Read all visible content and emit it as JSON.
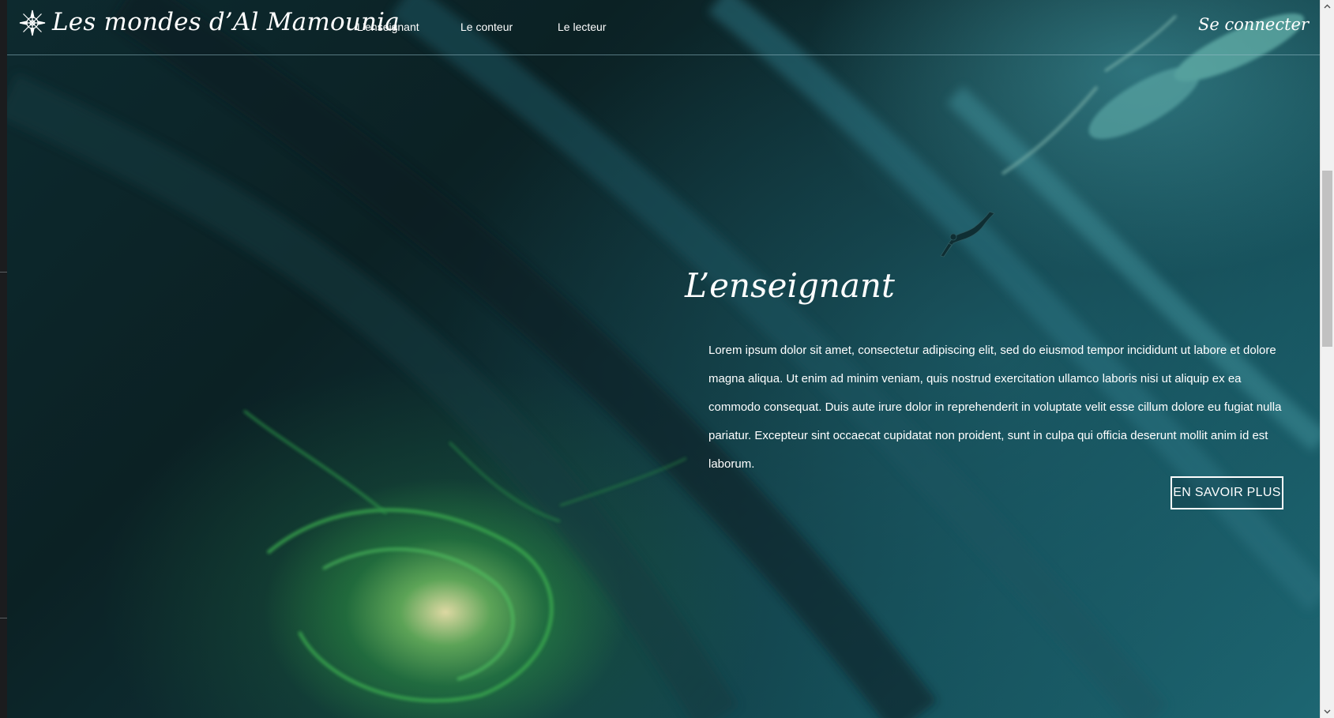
{
  "header": {
    "logo_icon": "compass-rose-icon",
    "site_title": "Les mondes d’Al Mamounia",
    "nav": [
      {
        "label": "L’enseignant"
      },
      {
        "label": "Le conteur"
      },
      {
        "label": "Le lecteur"
      }
    ],
    "login_label": "Se connecter"
  },
  "hero": {
    "title": "L’enseignant",
    "text": "Lorem ipsum dolor sit amet, consectetur adipiscing elit, sed do eiusmod tempor incididunt ut labore et dolore magna aliqua. Ut enim ad minim veniam, quis nostrud exercitation ullamco laboris nisi ut aliquip ex ea commodo consequat. Duis aute irure dolor in reprehenderit in voluptate velit esse cillum dolore eu fugiat nulla pariatur. Excepteur sint occaecat cupidatat non proident, sunt in culpa qui officia deserunt mollit anim id est laborum.",
    "button_label": "EN SAVOIR PLUS",
    "background_description_colors": {
      "deep": "#0b2124",
      "teal": "#1d6672",
      "glow": "#7fe07a"
    }
  },
  "scrollbar": {
    "up_icon": "chevron-up-icon",
    "down_icon": "chevron-down-icon"
  }
}
